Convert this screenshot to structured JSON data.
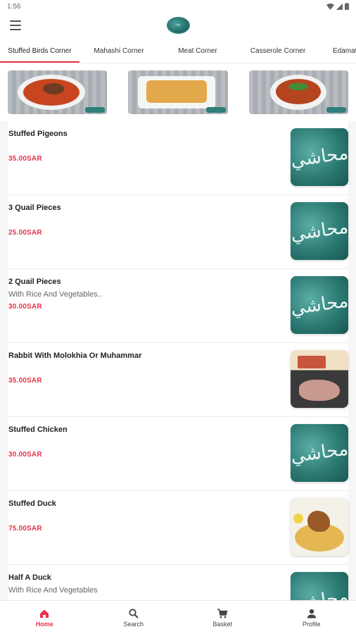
{
  "status": {
    "time": "1:56"
  },
  "tabs": [
    {
      "label": "Stuffed Birds Corner",
      "active": true
    },
    {
      "label": "Mahashi Corner",
      "active": false
    },
    {
      "label": "Meat Corner",
      "active": false
    },
    {
      "label": "Casserole Corner",
      "active": false
    },
    {
      "label": "Edamat",
      "active": false
    }
  ],
  "items": [
    {
      "name": "Stuffed Pigeons",
      "desc": "",
      "price": "35.00SAR",
      "image": "logo"
    },
    {
      "name": "3 Quail Pieces",
      "desc": "",
      "price": "25.00SAR",
      "image": "logo"
    },
    {
      "name": "2 Quail Pieces",
      "desc": "With Rice And Vegetables..",
      "price": "30.00SAR",
      "image": "logo"
    },
    {
      "name": "Rabbit With Molokhia Or Muhammar",
      "desc": "",
      "price": "35.00SAR",
      "image": "rabbit-photo"
    },
    {
      "name": "Stuffed Chicken",
      "desc": "",
      "price": "30.00SAR",
      "image": "logo"
    },
    {
      "name": "Stuffed Duck",
      "desc": "",
      "price": "75.00SAR",
      "image": "duck-photo"
    },
    {
      "name": "Half A Duck",
      "desc": "With Rice And Vegetables",
      "price": "",
      "image": "logo"
    }
  ],
  "bottom_nav": {
    "home": "Home",
    "search": "Search",
    "basket": "Basket",
    "profile": "Profile"
  },
  "colors": {
    "accent": "#e8324a",
    "brand_teal": "#2c7a74"
  },
  "icons": [
    "menu-icon",
    "home-icon",
    "search-icon",
    "basket-icon",
    "profile-icon",
    "wifi-icon",
    "signal-icon",
    "battery-icon"
  ]
}
